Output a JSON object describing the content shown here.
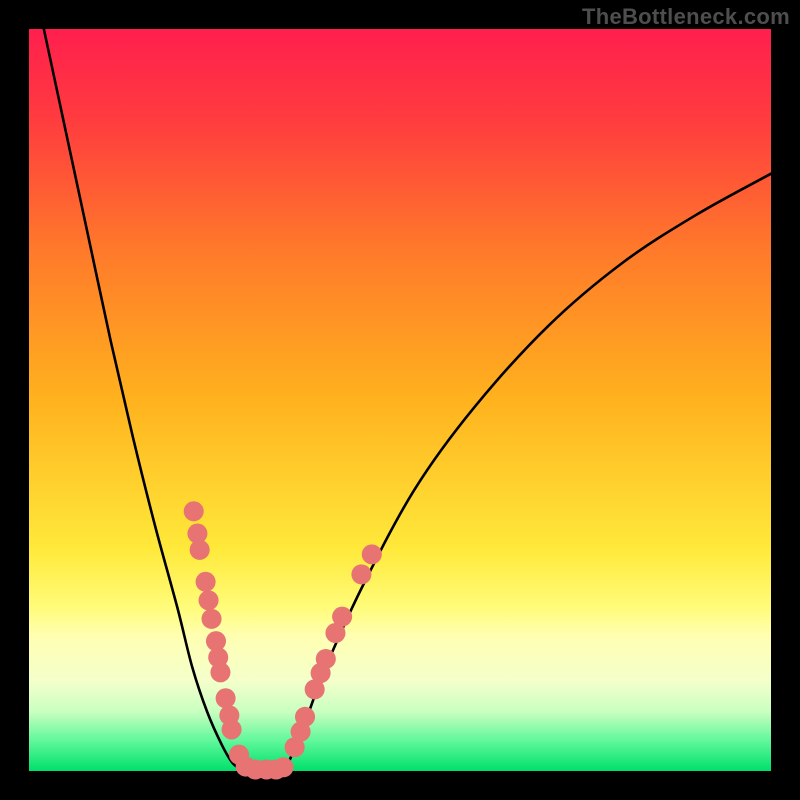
{
  "watermark": "TheBottleneck.com",
  "chart_data": {
    "type": "line",
    "title": "",
    "xlabel": "",
    "ylabel": "",
    "xlim": [
      0,
      100
    ],
    "ylim": [
      0,
      100
    ],
    "gradient_stops": [
      {
        "pos": 0,
        "color": "#ff1f4e"
      },
      {
        "pos": 12,
        "color": "#ff3b3f"
      },
      {
        "pos": 30,
        "color": "#ff7a2a"
      },
      {
        "pos": 50,
        "color": "#ffb21e"
      },
      {
        "pos": 70,
        "color": "#ffe93a"
      },
      {
        "pos": 78,
        "color": "#fffc7a"
      },
      {
        "pos": 82,
        "color": "#ffffb3"
      },
      {
        "pos": 88,
        "color": "#f3ffcb"
      },
      {
        "pos": 92,
        "color": "#c9ffc0"
      },
      {
        "pos": 96,
        "color": "#5ef79a"
      },
      {
        "pos": 100,
        "color": "#00e06a"
      }
    ],
    "series": [
      {
        "name": "bottleneck-curve-left",
        "color": "#000000",
        "x": [
          2.0,
          5.0,
          8.0,
          11.0,
          14.0,
          17.0,
          20.0,
          22.0,
          24.0,
          26.0,
          27.5,
          29.0
        ],
        "y": [
          100.0,
          86.0,
          72.0,
          58.0,
          45.0,
          33.0,
          22.0,
          14.0,
          8.0,
          3.5,
          1.0,
          0.0
        ]
      },
      {
        "name": "bottleneck-curve-flat",
        "color": "#000000",
        "x": [
          29.0,
          31.0,
          33.0,
          34.5
        ],
        "y": [
          0.0,
          0.0,
          0.0,
          0.0
        ]
      },
      {
        "name": "bottleneck-curve-right",
        "color": "#000000",
        "x": [
          34.5,
          37.0,
          40.0,
          45.0,
          52.0,
          60.0,
          70.0,
          80.0,
          90.0,
          100.0
        ],
        "y": [
          0.0,
          6.0,
          14.0,
          25.0,
          38.0,
          49.0,
          60.0,
          68.5,
          75.0,
          80.5
        ]
      }
    ],
    "scatter": {
      "name": "data-points",
      "color": "#e77373",
      "radius": 1.35,
      "points": [
        {
          "x": 22.2,
          "y": 35.0
        },
        {
          "x": 22.7,
          "y": 32.0
        },
        {
          "x": 23.0,
          "y": 29.8
        },
        {
          "x": 23.8,
          "y": 25.5
        },
        {
          "x": 24.2,
          "y": 23.0
        },
        {
          "x": 24.6,
          "y": 20.5
        },
        {
          "x": 25.2,
          "y": 17.5
        },
        {
          "x": 25.5,
          "y": 15.3
        },
        {
          "x": 25.8,
          "y": 13.3
        },
        {
          "x": 26.5,
          "y": 9.8
        },
        {
          "x": 27.0,
          "y": 7.5
        },
        {
          "x": 27.3,
          "y": 5.6
        },
        {
          "x": 28.3,
          "y": 2.2
        },
        {
          "x": 29.2,
          "y": 0.6
        },
        {
          "x": 30.5,
          "y": 0.2
        },
        {
          "x": 32.0,
          "y": 0.2
        },
        {
          "x": 33.3,
          "y": 0.2
        },
        {
          "x": 34.3,
          "y": 0.5
        },
        {
          "x": 35.8,
          "y": 3.2
        },
        {
          "x": 36.6,
          "y": 5.3
        },
        {
          "x": 37.2,
          "y": 7.3
        },
        {
          "x": 38.5,
          "y": 11.0
        },
        {
          "x": 39.3,
          "y": 13.2
        },
        {
          "x": 40.0,
          "y": 15.1
        },
        {
          "x": 41.3,
          "y": 18.6
        },
        {
          "x": 42.2,
          "y": 20.8
        },
        {
          "x": 44.8,
          "y": 26.5
        },
        {
          "x": 46.2,
          "y": 29.2
        }
      ]
    }
  }
}
